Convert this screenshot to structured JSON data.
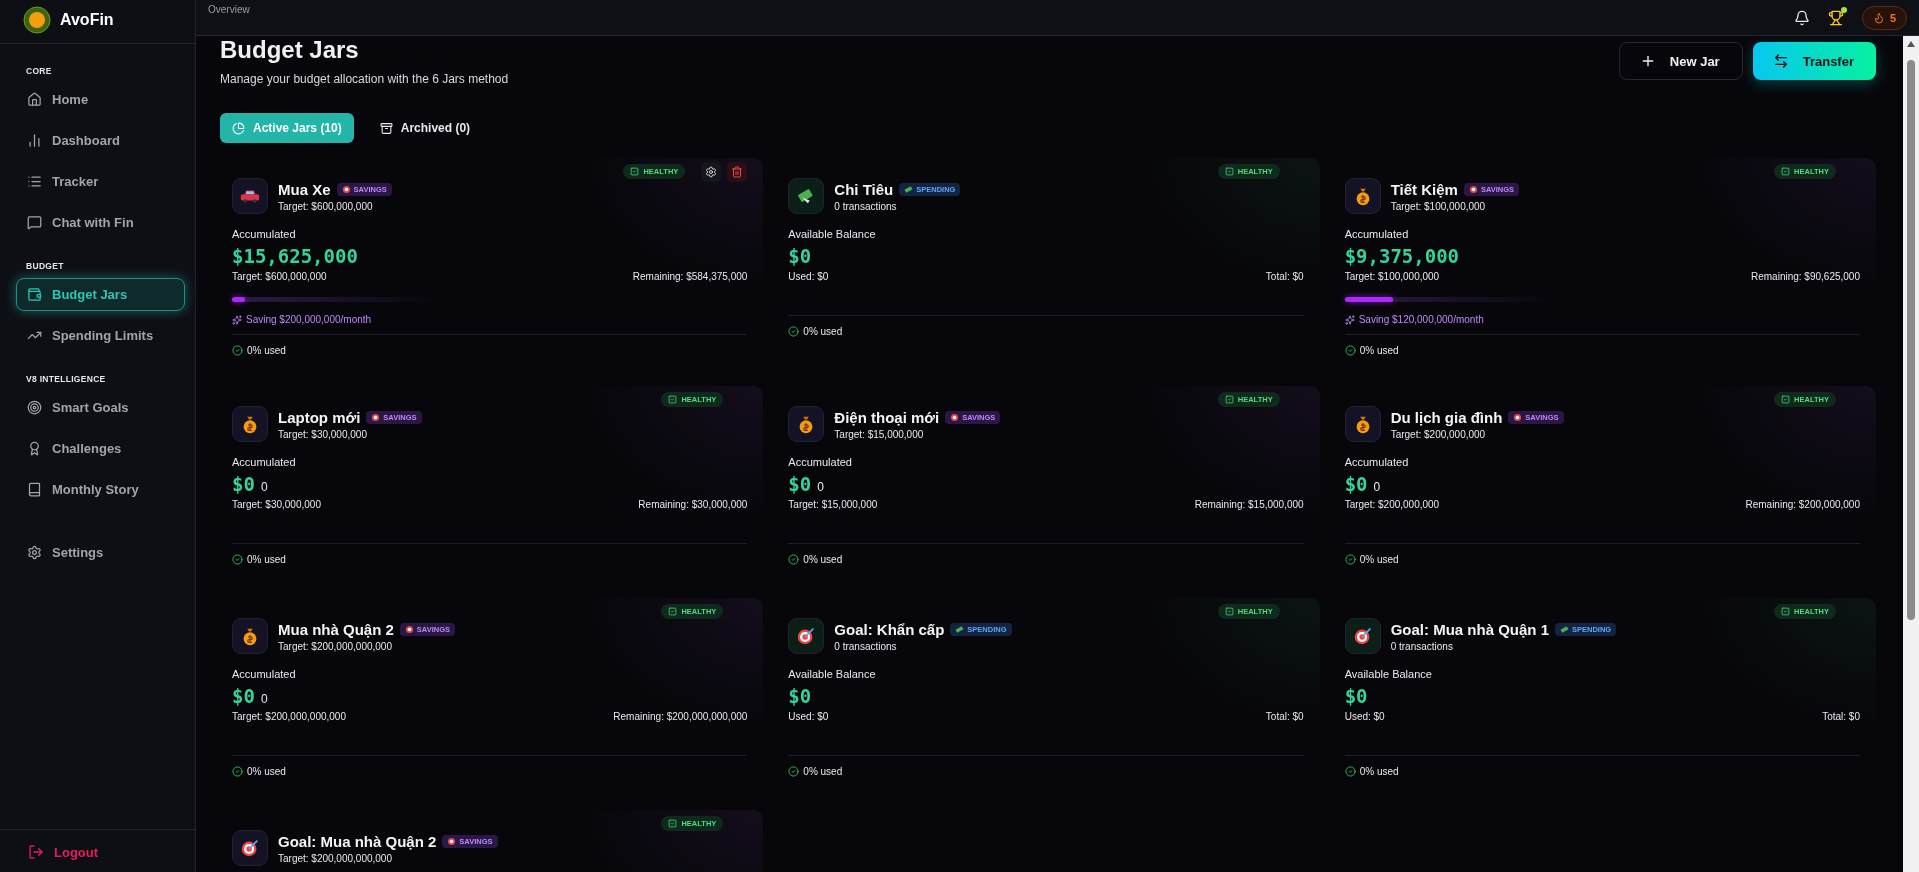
{
  "app": {
    "name": "AvoFin"
  },
  "sidebar": {
    "sections": [
      {
        "title": "CORE",
        "items": [
          {
            "label": "Home",
            "selected": false
          },
          {
            "label": "Dashboard",
            "selected": false
          },
          {
            "label": "Tracker",
            "selected": false
          },
          {
            "label": "Chat with Fin",
            "selected": false
          }
        ]
      },
      {
        "title": "BUDGET",
        "items": [
          {
            "label": "Budget Jars",
            "selected": true
          },
          {
            "label": "Spending Limits",
            "selected": false
          }
        ]
      },
      {
        "title": "V8 INTELLIGENCE",
        "items": [
          {
            "label": "Smart Goals",
            "selected": false
          },
          {
            "label": "Challenges",
            "selected": false
          },
          {
            "label": "Monthly Story",
            "selected": false
          }
        ]
      },
      {
        "items": [
          {
            "label": "Settings",
            "selected": false
          }
        ]
      }
    ],
    "logout": "Logout"
  },
  "topbar": {
    "breadcrumb": "Overview",
    "trophy_new": true,
    "streak": "5"
  },
  "page": {
    "title": "Budget Jars",
    "subtitle": "Manage your budget allocation with the 6 Jars method",
    "actions": [
      {
        "label": "New Jar",
        "kind": "outline"
      },
      {
        "label": "Transfer",
        "kind": "primary"
      }
    ]
  },
  "tabs": [
    {
      "label": "Active Jars (10)",
      "selected": true
    },
    {
      "label": "Archived (0)",
      "selected": false
    }
  ],
  "jars": [
    {
      "name": "Mua Xe",
      "kind": "savings",
      "type_label": "SAVINGS",
      "subtitle": "Target: $600,000,000",
      "status": "HEALTHY",
      "show_actions": true,
      "balance_label": "Accumulated",
      "amount": "$15,625,000",
      "left": "Target: $600,000,000",
      "right": "Remaining: $584,375,000",
      "level": 0.026,
      "saving": "Saving $200,000,000/month",
      "usage": "0% used"
    },
    {
      "name": "Chi Tiêu",
      "kind": "spending",
      "type_label": "SPENDING",
      "subtitle": "0 transactions",
      "status": "HEALTHY",
      "show_actions": false,
      "balance_label": "Available Balance",
      "amount": "$0",
      "left": "Used: $0",
      "right": "Total: $0",
      "usage": "0% used"
    },
    {
      "name": "Tiết Kiệm",
      "kind": "savings",
      "type_label": "SAVINGS",
      "subtitle": "Target: $100,000,000",
      "status": "HEALTHY",
      "show_actions": false,
      "balance_label": "Accumulated",
      "amount": "$9,375,000",
      "left": "Target: $100,000,000",
      "right": "Remaining: $90,625,000",
      "level": 0.094,
      "saving": "Saving $120,000,000/month",
      "usage": "0% used"
    },
    {
      "name": "Laptop mới",
      "kind": "savings",
      "type_label": "SAVINGS",
      "subtitle": "Target: $30,000,000",
      "status": "HEALTHY",
      "show_actions": false,
      "balance_label": "Accumulated",
      "amount": "$0",
      "amount_suffix": "0",
      "left": "Target: $30,000,000",
      "right": "Remaining: $30,000,000",
      "usage": "0% used"
    },
    {
      "name": "Điện thoại mới",
      "kind": "savings",
      "type_label": "SAVINGS",
      "subtitle": "Target: $15,000,000",
      "status": "HEALTHY",
      "show_actions": false,
      "balance_label": "Accumulated",
      "amount": "$0",
      "amount_suffix": "0",
      "left": "Target: $15,000,000",
      "right": "Remaining: $15,000,000",
      "usage": "0% used"
    },
    {
      "name": "Du lịch gia đình",
      "kind": "savings",
      "type_label": "SAVINGS",
      "subtitle": "Target: $200,000,000",
      "status": "HEALTHY",
      "show_actions": false,
      "balance_label": "Accumulated",
      "amount": "$0",
      "amount_suffix": "0",
      "left": "Target: $200,000,000",
      "right": "Remaining: $200,000,000",
      "usage": "0% used"
    },
    {
      "name": "Mua nhà Quận 2",
      "kind": "savings",
      "type_label": "SAVINGS",
      "subtitle": "Target: $200,000,000,000",
      "status": "HEALTHY",
      "show_actions": false,
      "balance_label": "Accumulated",
      "amount": "$0",
      "amount_suffix": "0",
      "left": "Target: $200,000,000,000",
      "right": "Remaining: $200,000,000,000",
      "usage": "0% used"
    },
    {
      "name": "Goal: Khẩn cấp",
      "kind": "spending",
      "type_label": "SPENDING",
      "subtitle": "0 transactions",
      "status": "HEALTHY",
      "show_actions": false,
      "balance_label": "Available Balance",
      "amount": "$0",
      "left": "Used: $0",
      "right": "Total: $0",
      "usage": "0% used"
    },
    {
      "name": "Goal: Mua nhà Quận 1",
      "kind": "spending",
      "type_label": "SPENDING",
      "subtitle": "0 transactions",
      "status": "HEALTHY",
      "show_actions": false,
      "balance_label": "Available Balance",
      "amount": "$0",
      "left": "Used: $0",
      "right": "Total: $0",
      "usage": "0% used"
    },
    {
      "name": "Goal: Mua nhà Quận 2",
      "kind": "savings",
      "type_label": "SAVINGS",
      "subtitle": "Target: $200,000,000,000",
      "status": "HEALTHY",
      "show_actions": false
    }
  ]
}
